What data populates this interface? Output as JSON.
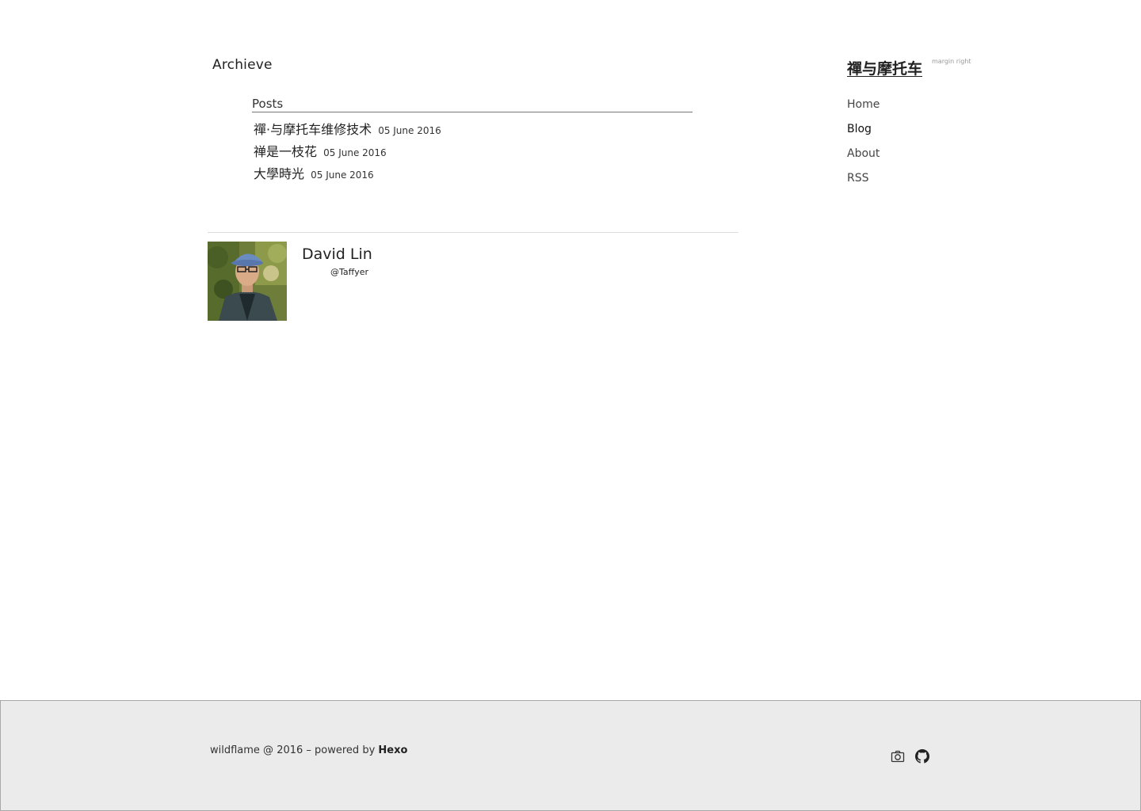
{
  "page": {
    "heading": "Archieve"
  },
  "archive": {
    "section_title": "Posts",
    "posts": [
      {
        "title": "禪·与摩托车维修技术",
        "date": "05 June 2016"
      },
      {
        "title": "禅是一枝花",
        "date": "05 June 2016"
      },
      {
        "title": "大學時光",
        "date": "05 June 2016"
      }
    ]
  },
  "author": {
    "name": "David Lin",
    "handle": "@Taffyer"
  },
  "sidebar": {
    "site_title": "禪与摩托车",
    "tagline": "margin right",
    "nav": [
      {
        "label": "Home"
      },
      {
        "label": "Blog",
        "active": true
      },
      {
        "label": "About"
      },
      {
        "label": "RSS"
      }
    ]
  },
  "footer": {
    "text": "wildflame @ 2016 – powered by ",
    "link_label": "Hexo",
    "icons": [
      "camera-icon",
      "github-icon"
    ]
  },
  "colors": {
    "footer_bg": "#ebebeb",
    "text": "#222222",
    "tagline": "#999999"
  }
}
